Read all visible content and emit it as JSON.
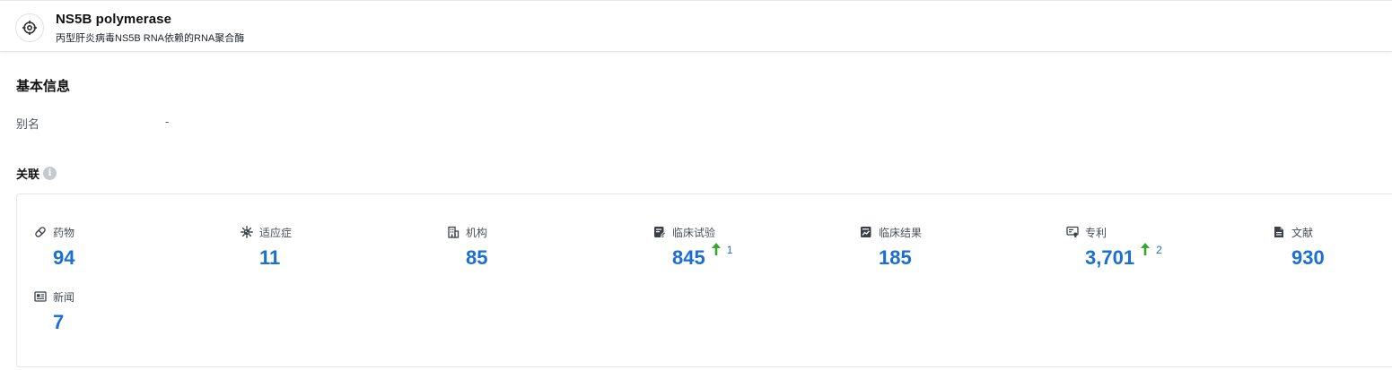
{
  "header": {
    "title": "NS5B polymerase",
    "subtitle": "丙型肝炎病毒NS5B RNA依赖的RNA聚合酶",
    "logo_icon": "target-crosshair-icon"
  },
  "basic_info": {
    "section_title": "基本信息",
    "alias_label": "别名",
    "alias_value": "-"
  },
  "relations": {
    "title": "关联",
    "info_icon_glyph": "i",
    "value_color": "#1a6fd1",
    "trend_color": "#3aa52e",
    "items": [
      {
        "key": "drugs",
        "label": "药物",
        "value": "94",
        "icon": "pill-icon"
      },
      {
        "key": "indications",
        "label": "适应症",
        "value": "11",
        "icon": "virus-icon"
      },
      {
        "key": "organizations",
        "label": "机构",
        "value": "85",
        "icon": "building-icon"
      },
      {
        "key": "clinical_trials",
        "label": "临床试验",
        "value": "845",
        "icon": "clipboard-edit-icon",
        "trend": "up",
        "trend_count": "1"
      },
      {
        "key": "clinical_results",
        "label": "临床结果",
        "value": "185",
        "icon": "chart-report-icon"
      },
      {
        "key": "patents",
        "label": "专利",
        "value": "3,701",
        "icon": "patent-certificate-icon",
        "trend": "up",
        "trend_count": "2"
      },
      {
        "key": "literature",
        "label": "文献",
        "value": "930",
        "icon": "document-icon"
      },
      {
        "key": "news",
        "label": "新闻",
        "value": "7",
        "icon": "newspaper-icon"
      }
    ]
  }
}
